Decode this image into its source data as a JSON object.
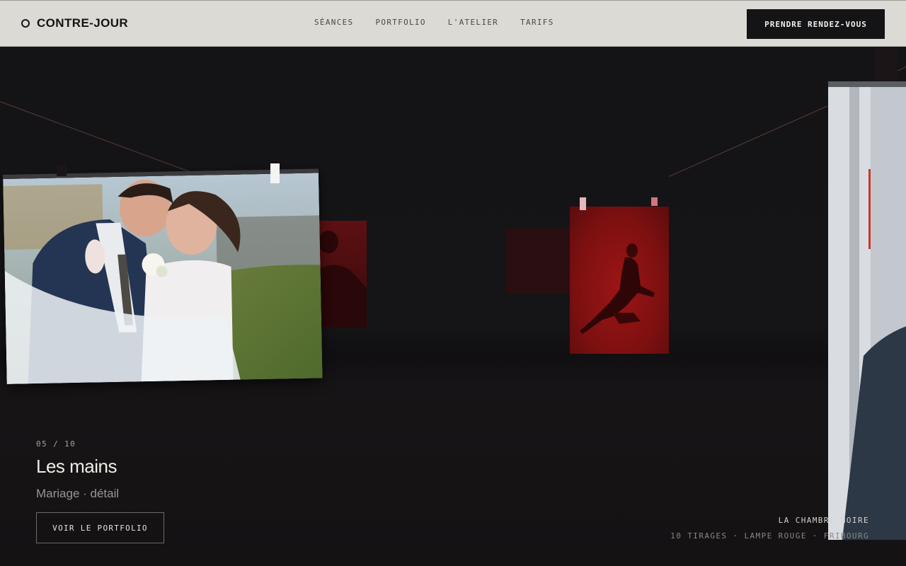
{
  "header": {
    "brand": "CONTRE-JOUR",
    "nav": [
      "SÉANCES",
      "PORTFOLIO",
      "L'ATELIER",
      "TARIFS"
    ],
    "cta": "PRENDRE RENDEZ-VOUS"
  },
  "slide": {
    "counter": "05 / 10",
    "title": "Les mains",
    "subtitle": "Mariage · détail",
    "cta": "VOIR LE PORTFOLIO"
  },
  "room": {
    "name": "LA CHAMBRE NOIRE",
    "meta": "10 TIRAGES · LAMPE ROUGE · FRIBOURG"
  },
  "colors": {
    "header_bg": "#dcdad5",
    "scene_bg": "#141316",
    "darkroom_red": "#8f1414",
    "clip_white": "#f4f4f4",
    "clip_pink": "#e3a7ac",
    "accent_red": "#c8372d"
  }
}
